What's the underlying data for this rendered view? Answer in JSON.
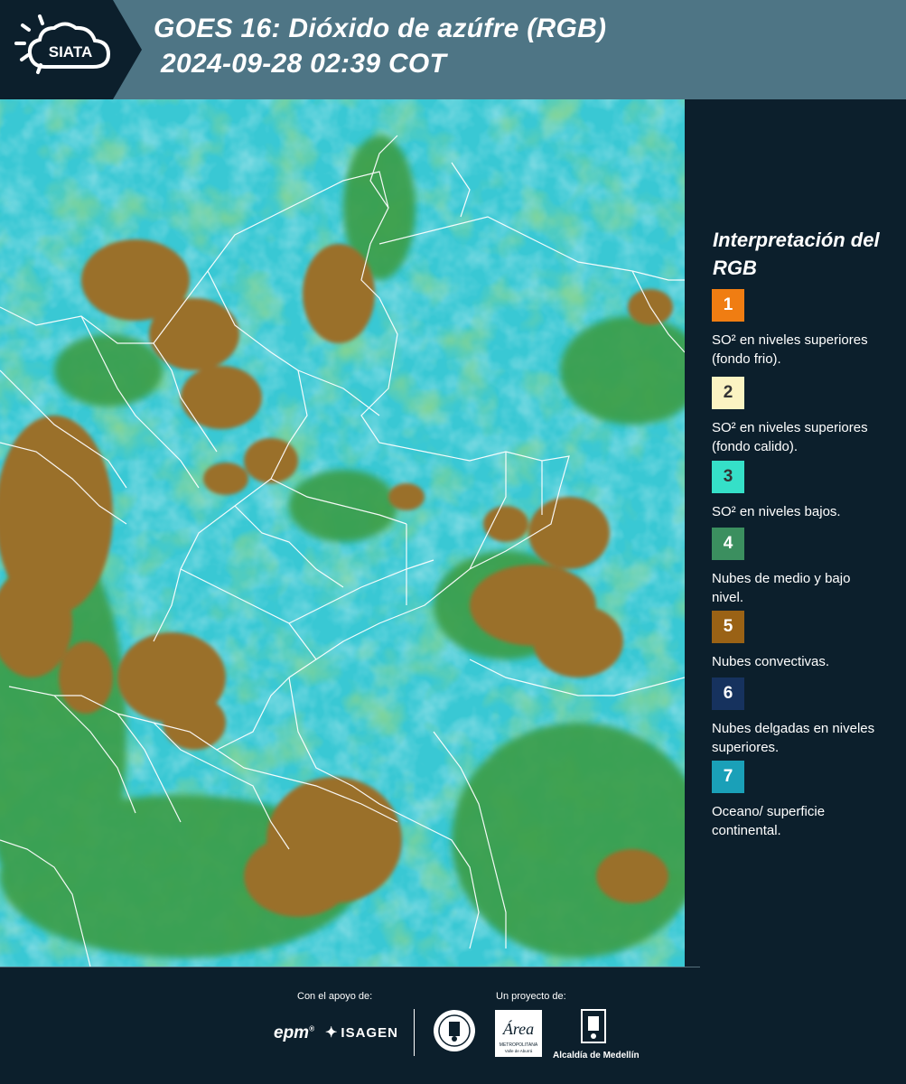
{
  "header": {
    "logo_text": "SIATA",
    "title_line1": "GOES 16: Dióxido de azúfre (RGB)",
    "title_line2": "2024-09-28 02:39 COT",
    "band_color": "#4e7585",
    "panel_color": "#0c1f2c"
  },
  "map": {
    "description_colors": {
      "ocean_surface": "#34c9d6",
      "mid_low_clouds": "#3aa94a",
      "convective_clouds": "#9a6f2a"
    }
  },
  "legend": {
    "title": "Interpretación del RGB",
    "items": [
      {
        "number": "1",
        "label": "SO² en niveles superiores (fondo frio).",
        "color": "#f07d12",
        "text_color": "#ffffff"
      },
      {
        "number": "2",
        "label": "SO² en niveles superiores (fondo calido).",
        "color": "#fbf3c2",
        "text_color": "#333333"
      },
      {
        "number": "3",
        "label": "SO² en niveles bajos.",
        "color": "#35e0c8",
        "text_color": "#333333"
      },
      {
        "number": "4",
        "label": "Nubes de medio y bajo nivel.",
        "color": "#3b8f5f",
        "text_color": "#ffffff"
      },
      {
        "number": "5",
        "label": "Nubes convectivas.",
        "color": "#9a6215",
        "text_color": "#ffffff"
      },
      {
        "number": "6",
        "label": "Nubes delgadas en niveles superiores.",
        "color": "#16325e",
        "text_color": "#ffffff"
      },
      {
        "number": "7",
        "label": "Oceano/ superficie continental.",
        "color": "#1aa0b8",
        "text_color": "#ffffff"
      }
    ]
  },
  "footer": {
    "support_label": "Con el apoyo de:",
    "project_label": "Un proyecto de:",
    "sponsor_1": "epm",
    "sponsor_2": "ISAGEN",
    "partner_1": "Área Metropolitana Valle de Aburrá",
    "partner_2": "Alcaldía de Medellín"
  }
}
